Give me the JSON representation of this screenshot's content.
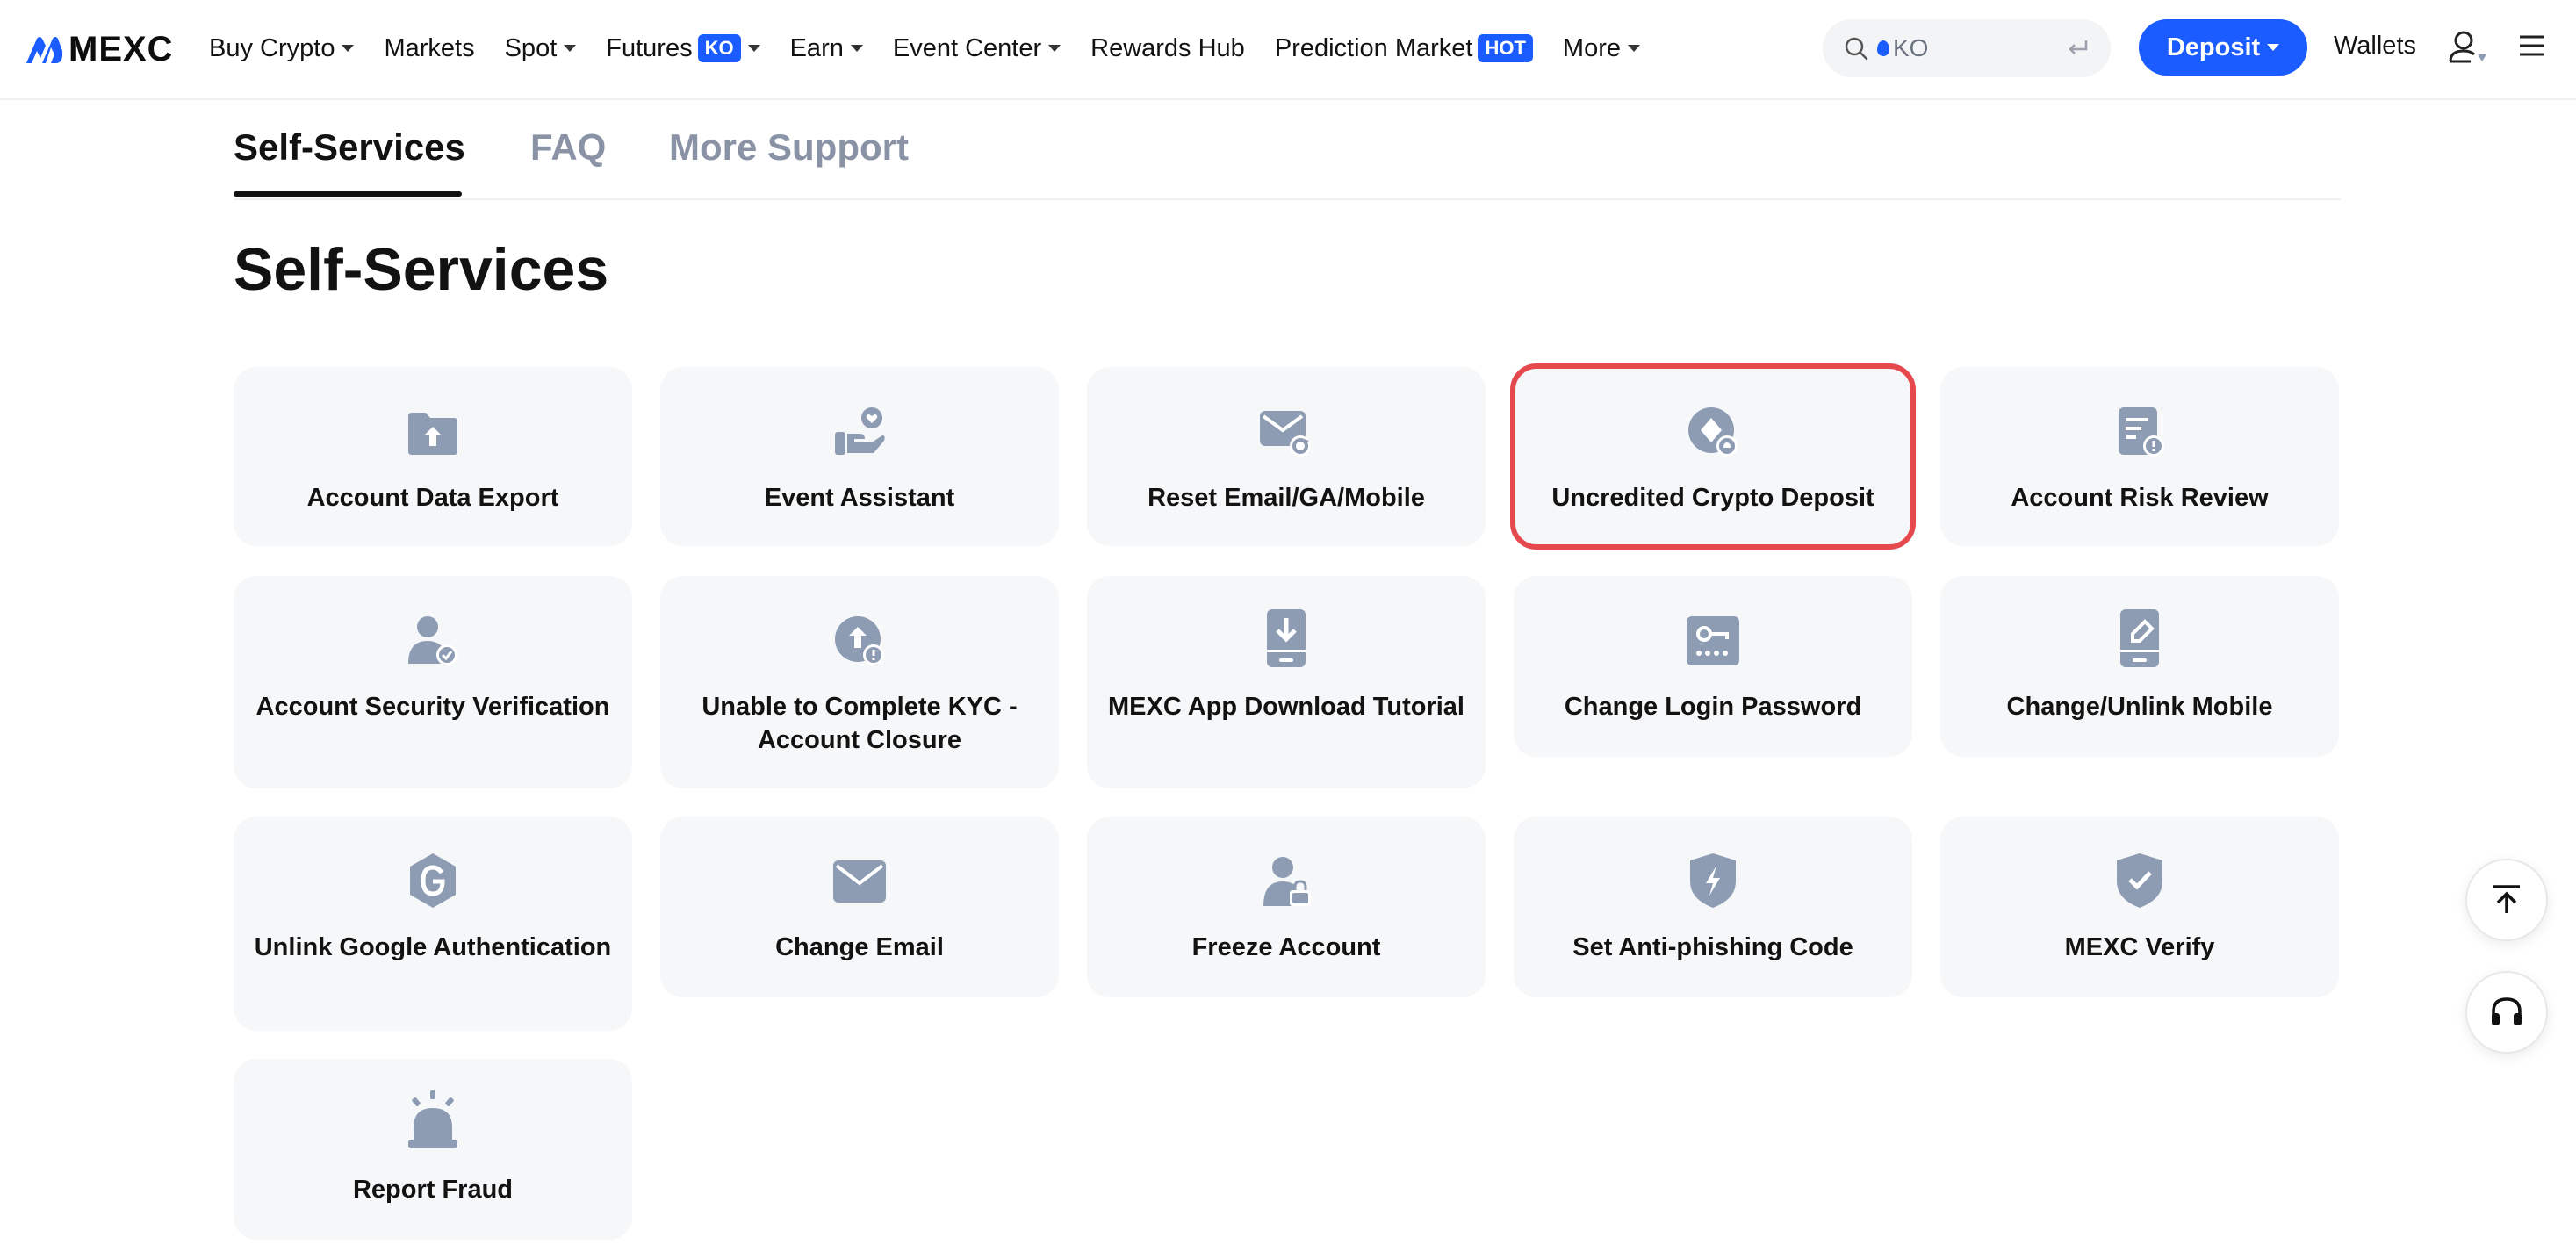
{
  "header": {
    "logo_text": "MEXC",
    "nav": [
      {
        "label": "Buy Crypto",
        "caret": true
      },
      {
        "label": "Markets",
        "caret": false
      },
      {
        "label": "Spot",
        "caret": true
      },
      {
        "label": "Futures",
        "badge": "KO",
        "caret": true
      },
      {
        "label": "Earn",
        "caret": true
      },
      {
        "label": "Event Center",
        "caret": true
      },
      {
        "label": "Rewards Hub",
        "caret": false
      },
      {
        "label": "Prediction Market",
        "badge": "HOT",
        "caret": false
      },
      {
        "label": "More",
        "caret": true
      }
    ],
    "search_value": "KO",
    "deposit_label": "Deposit",
    "wallets_label": "Wallets"
  },
  "tabs": [
    "Self-Services",
    "FAQ",
    "More Support"
  ],
  "page_title": "Self-Services",
  "cards": [
    {
      "label": "Account Data Export",
      "icon": "folder-upload-icon"
    },
    {
      "label": "Event Assistant",
      "icon": "hand-heart-icon"
    },
    {
      "label": "Reset Email/GA/Mobile",
      "icon": "mail-reset-icon"
    },
    {
      "label": "Uncredited Crypto Deposit",
      "icon": "crypto-deposit-icon",
      "highlighted": true
    },
    {
      "label": "Account Risk Review",
      "icon": "document-alert-icon"
    },
    {
      "label": "Account Security Verification",
      "icon": "user-check-icon"
    },
    {
      "label": "Unable to Complete KYC - Account Closure",
      "icon": "upload-alert-icon"
    },
    {
      "label": "MEXC App Download Tutorial",
      "icon": "phone-download-icon"
    },
    {
      "label": "Change Login Password",
      "icon": "key-password-icon"
    },
    {
      "label": "Change/Unlink Mobile",
      "icon": "phone-edit-icon"
    },
    {
      "label": "Unlink Google Authentication",
      "icon": "google-shield-icon"
    },
    {
      "label": "Change Email",
      "icon": "envelope-icon"
    },
    {
      "label": "Freeze Account",
      "icon": "user-lock-icon"
    },
    {
      "label": "Set Anti-phishing Code",
      "icon": "shield-bolt-icon"
    },
    {
      "label": "MEXC Verify",
      "icon": "shield-check-icon"
    },
    {
      "label": "Report Fraud",
      "icon": "siren-icon"
    }
  ],
  "colors": {
    "accent": "#1a5cff",
    "icon": "#8d9bb3",
    "card_bg": "#f6f7f9",
    "highlight": "#e5484d"
  }
}
